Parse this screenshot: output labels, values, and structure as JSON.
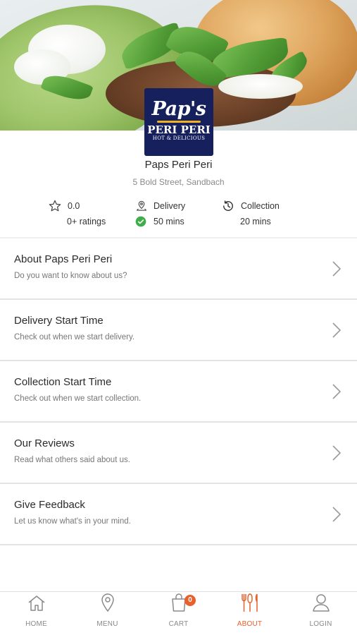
{
  "restaurant": {
    "name": "Paps Peri Peri",
    "address": "5 Bold Street, Sandbach",
    "logo": {
      "line1": "Pap's",
      "line2": "PERI PERI",
      "line3": "HOT & DELICIOUS"
    }
  },
  "stats": {
    "rating": {
      "value": "0.0",
      "count_label": "0+ ratings",
      "icon": "star-outline-icon"
    },
    "delivery": {
      "label": "Delivery",
      "time": "50 mins",
      "icon": "map-pin-icon",
      "status_icon": "check-circle-icon"
    },
    "collection": {
      "label": "Collection",
      "time": "20 mins",
      "icon": "history-clock-icon"
    }
  },
  "menu": {
    "items": [
      {
        "title": "About Paps Peri Peri",
        "subtitle": "Do you want to know about us?"
      },
      {
        "title": "Delivery Start Time",
        "subtitle": "Check out when we start delivery."
      },
      {
        "title": "Collection Start Time",
        "subtitle": "Check out when we start collection."
      },
      {
        "title": "Our Reviews",
        "subtitle": "Read what others said about us."
      },
      {
        "title": "Give Feedback",
        "subtitle": "Let us know what's in your mind."
      }
    ]
  },
  "tabbar": {
    "tabs": [
      {
        "label": "HOME",
        "icon": "home-icon"
      },
      {
        "label": "MENU",
        "icon": "location-pin-icon"
      },
      {
        "label": "CART",
        "icon": "shopping-bag-icon",
        "badge": "0"
      },
      {
        "label": "ABOUT",
        "icon": "cutlery-icon",
        "active": true
      },
      {
        "label": "LOGIN",
        "icon": "user-icon"
      }
    ]
  },
  "colors": {
    "accent": "#e8602c",
    "check_green": "#3fae4a",
    "logo_bg": "#15205c",
    "logo_swoosh": "#f2b21f"
  }
}
